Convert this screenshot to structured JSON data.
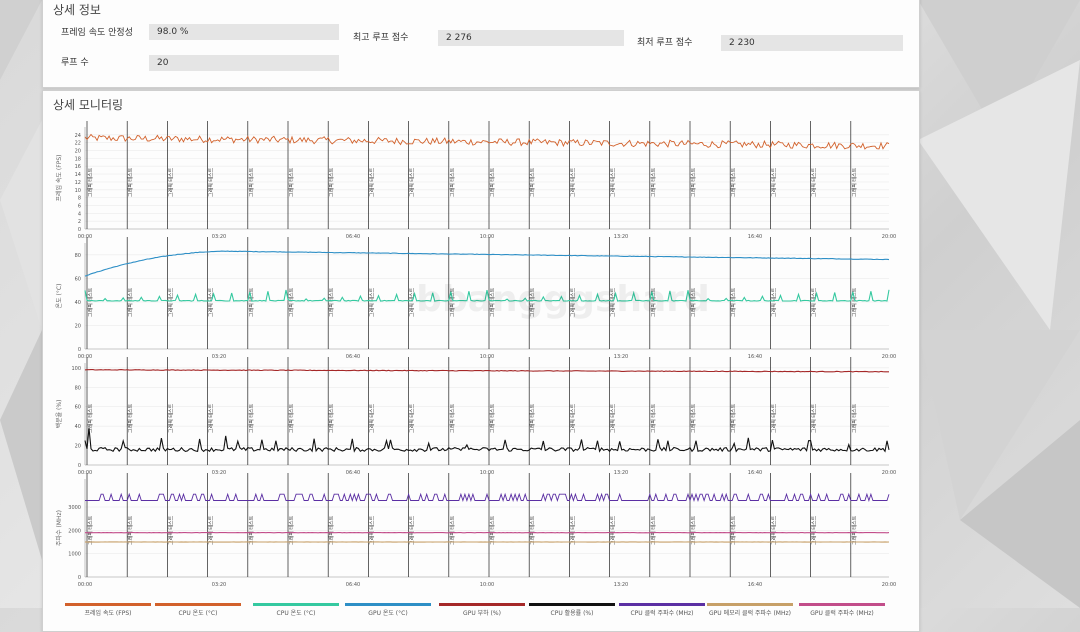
{
  "info": {
    "title": "상세 정보",
    "stability_label": "프레임 속도 안정성",
    "stability_value": "98.0 %",
    "loops_label": "루프 수",
    "loops_value": "20",
    "best_label": "최고 루프 점수",
    "best_value": "2 276",
    "worst_label": "최저 루프 점수",
    "worst_value": "2 230"
  },
  "monitor": {
    "title": "상세 모니터링",
    "watermark": "bbangggshard",
    "loop_marker_label": "그래픽 테스트",
    "time_ticks": [
      "00:00",
      "03:20",
      "06:40",
      "10:00",
      "13:20",
      "16:40",
      "20:00"
    ],
    "loop_count": 20
  },
  "chart_data": [
    {
      "type": "line",
      "ylabel": "프레임 속도 (FPS)",
      "ylim": [
        0,
        26
      ],
      "yticks": [
        0,
        2,
        4,
        6,
        8,
        10,
        12,
        14,
        16,
        18,
        20,
        22,
        24
      ],
      "x_range": [
        "00:00",
        "20:00"
      ],
      "series": [
        {
          "name": "프레임 속도 (FPS)",
          "color": "#d2612b",
          "start": 23.2,
          "end": 21.2,
          "noise": 0.9
        }
      ]
    },
    {
      "type": "line",
      "ylabel": "온도 (°C)",
      "ylim": [
        0,
        90
      ],
      "yticks": [
        0,
        20,
        40,
        60,
        80
      ],
      "x_range": [
        "00:00",
        "20:00"
      ],
      "series": [
        {
          "name": "CPU 온도 (°C)",
          "color": "#2e8fc6",
          "start": 62,
          "peak": 83,
          "end": 76
        },
        {
          "name": "GPU 온도 (°C)",
          "color": "#35c9a0",
          "base": 41,
          "spike": 50
        }
      ]
    },
    {
      "type": "line",
      "ylabel": "백분율 (%)",
      "ylim": [
        0,
        105
      ],
      "yticks": [
        0,
        20,
        40,
        60,
        80,
        100
      ],
      "x_range": [
        "00:00",
        "20:00"
      ],
      "series": [
        {
          "name": "GPU 부하 (%)",
          "color": "#a52828",
          "start": 98,
          "end": 96
        },
        {
          "name": "CPU 활용률 (%)",
          "color": "#111111",
          "base": 16,
          "spikes": [
            38,
            30,
            28,
            35,
            25,
            26,
            30,
            22
          ]
        }
      ]
    },
    {
      "type": "line",
      "ylabel": "주파수 (MHz)",
      "ylim": [
        0,
        4200
      ],
      "yticks": [
        0,
        1000,
        2000,
        3000
      ],
      "x_range": [
        "00:00",
        "20:00"
      ],
      "series": [
        {
          "name": "CPU 클럭 주파수 (MHz)",
          "color": "#5b2fa3",
          "base": 3280,
          "high": 3550
        },
        {
          "name": "GPU 메모리 클럭 주파수 (MHz)",
          "color": "#c7a068",
          "value": 1500
        },
        {
          "name": "GPU 클럭 주파수 (MHz)",
          "color": "#c24d8a",
          "value": 1900
        }
      ]
    }
  ],
  "legend": [
    {
      "label": "프레임 속도 (FPS)",
      "color": "#d2612b"
    },
    {
      "label": "CPU 온도 (°C)",
      "color": "#d2612b"
    },
    {
      "label": "CPU 온도 (°C)",
      "color": "#35c9a0"
    },
    {
      "label": "GPU 온도 (°C)",
      "color": "#2e8fc6"
    },
    {
      "label": "GPU 부하 (%)",
      "color": "#a52828"
    },
    {
      "label": "CPU 활용률 (%)",
      "color": "#111111"
    },
    {
      "label": "CPU 클럭 주파수 (MHz)",
      "color": "#5b2fa3"
    },
    {
      "label": "GPU 메모리 클럭 주파수 (MHz)",
      "color": "#c7a068"
    },
    {
      "label": "GPU 클럭 주파수 (MHz)",
      "color": "#c24d8a"
    }
  ]
}
